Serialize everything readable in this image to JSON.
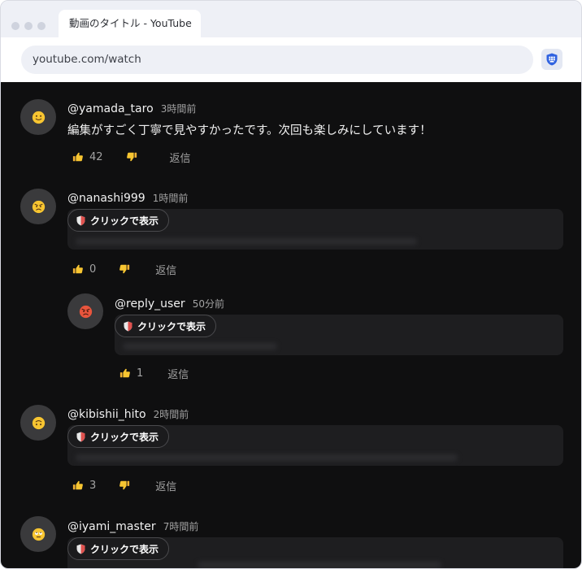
{
  "browser": {
    "tab_title": "動画のタイトル - YouTube",
    "url": "youtube.com/watch",
    "extension_icon": "shield-grid-icon"
  },
  "hidden_label": "クリックで表示",
  "reply_label": "返信",
  "comments": [
    {
      "username": "@yamada_taro",
      "time": "3時間前",
      "text": "編集がすごく丁寧で見やすかったです。次回も楽しみにしています！",
      "likes": "42",
      "avatar_emoji": "slightly-smiling-face",
      "hidden": false
    },
    {
      "username": "@nanashi999",
      "time": "1時間前",
      "likes": "0",
      "avatar_emoji": "angry-face",
      "hidden": true
    },
    {
      "username": "@reply_user",
      "time": "50分前",
      "likes": "1",
      "avatar_emoji": "pouting-face",
      "hidden": true,
      "is_reply": true
    },
    {
      "username": "@kibishii_hito",
      "time": "2時間前",
      "likes": "3",
      "avatar_emoji": "upside-down-face",
      "hidden": true
    },
    {
      "username": "@iyami_master",
      "time": "7時間前",
      "avatar_emoji": "rolling-eyes-face",
      "hidden": true
    }
  ],
  "colors": {
    "page_bg": "#0f0f10",
    "text_primary": "#f1f1f1",
    "text_secondary": "#a3a3a3",
    "extension_accent": "#2f62e0"
  }
}
